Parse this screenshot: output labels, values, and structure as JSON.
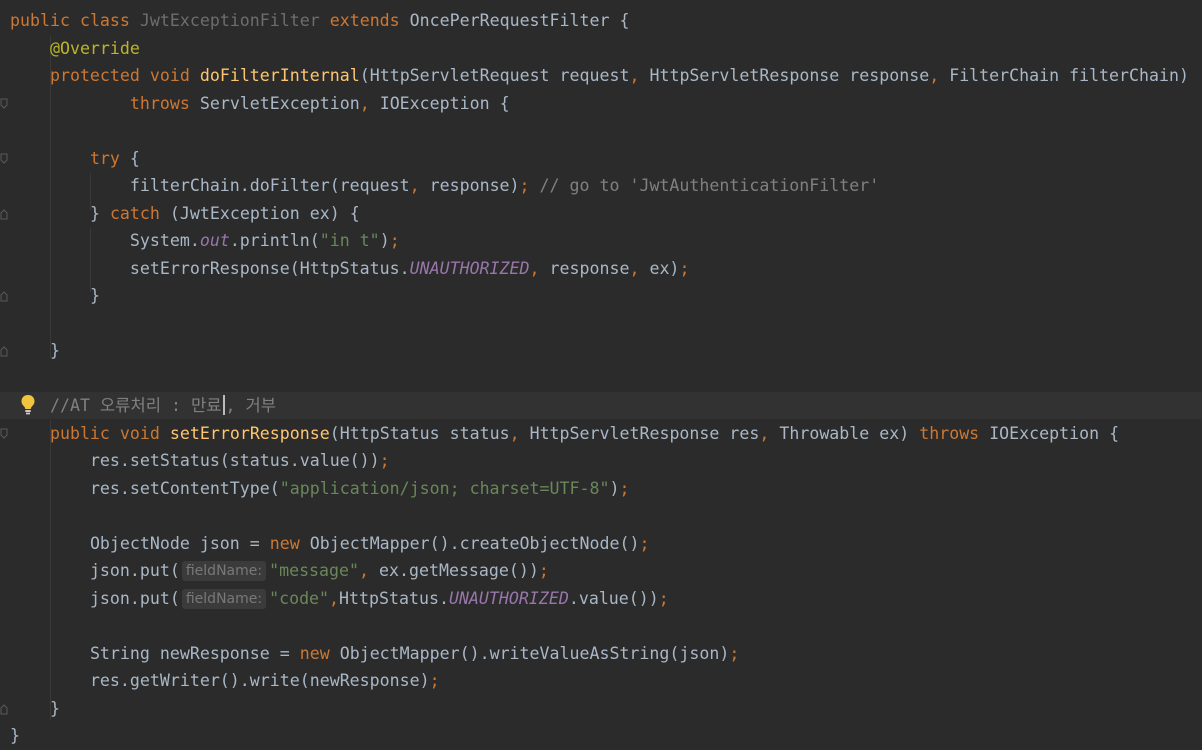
{
  "code": {
    "line_class_decl": {
      "kw_public": "public",
      "kw_class": "class",
      "class_name": "JwtExceptionFilter",
      "kw_extends": "extends",
      "super_class": "OncePerRequestFilter",
      "brace": "{"
    },
    "line_override": {
      "annotation": "@Override"
    },
    "line_method_sig": {
      "kw_protected": "protected",
      "kw_void": "void",
      "method_name": "doFilterInternal",
      "open": "(",
      "param1": "HttpServletRequest request",
      "comma1": ",",
      "param2": "HttpServletResponse response",
      "comma2": ",",
      "param3": "FilterChain filterChain",
      "close": ")"
    },
    "line_throws": {
      "kw_throws": "throws",
      "ex1": "ServletException",
      "comma": ",",
      "ex2": "IOException {"
    },
    "line_try": {
      "kw_try": "try",
      "rest": "{"
    },
    "line_dofilter": {
      "call": "filterChain.doFilter(request",
      "comma": ",",
      "arg": "response)",
      "semi": ";",
      "comment": "// go to 'JwtAuthenticationFilter'"
    },
    "line_catch": {
      "close": "}",
      "kw_catch": "catch",
      "rest": "(JwtException ex) {"
    },
    "line_println": {
      "prefix": "System.",
      "field": "out",
      "call": ".println(",
      "str": "\"in t\"",
      "end": ")",
      "semi": ";"
    },
    "line_seterror_call": {
      "call": "setErrorResponse(HttpStatus.",
      "field": "UNAUTHORIZED",
      "comma1": ",",
      "arg2": "response",
      "comma2": ",",
      "arg3": "ex)",
      "semi": ";"
    },
    "line_close_catch": {
      "text": "}"
    },
    "line_close_method1": {
      "text": "}"
    },
    "line_comment": {
      "before_caret": "//AT 오류처리 : 만료",
      "after_caret": ", 거부"
    },
    "line_method2_sig": {
      "kw_public": "public",
      "kw_void": "void",
      "method_name": "setErrorResponse",
      "params": "(HttpStatus status",
      "comma1": ",",
      "param2": "HttpServletResponse res",
      "comma2": ",",
      "param3": "Throwable ex)",
      "kw_throws": "throws",
      "rest": "IOException {"
    },
    "line_setstatus": {
      "text": "res.setStatus(status.value())",
      "semi": ";"
    },
    "line_setcontenttype": {
      "call": "res.setContentType(",
      "str": "\"application/json; charset=UTF-8\"",
      "end": ")",
      "semi": ";"
    },
    "line_objectnode": {
      "decl": "ObjectNode json = ",
      "kw_new": "new",
      "rest": "ObjectMapper().createObjectNode()",
      "semi": ";"
    },
    "line_put_message": {
      "call": "json.put(",
      "hint": "fieldName:",
      "str": "\"message\"",
      "comma": ",",
      "rest": "ex.getMessage())",
      "semi": ";"
    },
    "line_put_code": {
      "call": "json.put(",
      "hint": "fieldName:",
      "str": "\"code\"",
      "comma": ",",
      "mid": "HttpStatus.",
      "field": "UNAUTHORIZED",
      "rest": ".value())",
      "semi": ";"
    },
    "line_newresponse": {
      "decl": "String newResponse = ",
      "kw_new": "new",
      "rest": "ObjectMapper().writeValueAsString(json)",
      "semi": ";"
    },
    "line_write": {
      "text": "res.getWriter().write(newResponse)",
      "semi": ";"
    },
    "line_close_method2": {
      "text": "}"
    },
    "line_close_class": {
      "text": "}"
    }
  },
  "colors": {
    "background": "#2b2b2b",
    "current_line": "#323232",
    "text": "#a9b7c6",
    "keyword": "#cc7832",
    "annotation": "#bbb529",
    "method_declaration": "#ffc66d",
    "string": "#6a8759",
    "comment": "#808080",
    "static_field": "#9876aa",
    "intention_bulb": "#f0c43c"
  },
  "icons": {
    "gutter_bulb": "lightbulb-icon",
    "gutter_fold": "fold-marker-icon"
  }
}
